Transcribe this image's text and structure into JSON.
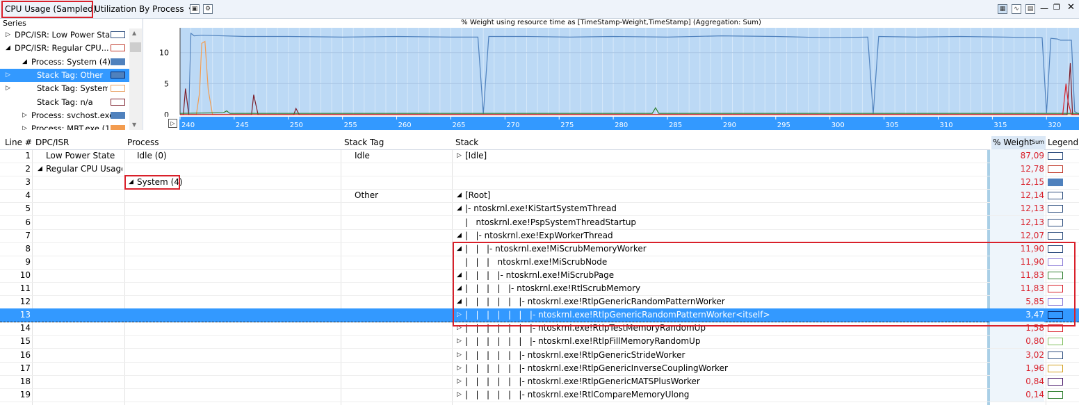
{
  "toolbar": {
    "graph_title": "CPU Usage (Sampled)",
    "view_select": "Utilization By Process",
    "dropdown_glyph": "▾"
  },
  "series_panel": {
    "header": "Series",
    "items": [
      {
        "label": "DPC/ISR: Low Power Sta...",
        "expand": "▷",
        "color": "#ffffff",
        "border": "#2f4f7f",
        "indent": 1
      },
      {
        "label": "DPC/ISR: Regular CPU...",
        "expand": "◢",
        "color": "#ffffff",
        "border": "#c0392b",
        "indent": 1
      },
      {
        "label": "Process: System (4)",
        "expand": "◢",
        "color": "#4f81bd",
        "border": "#4f81bd",
        "indent": 2
      },
      {
        "label": "Stack Tag: Other",
        "expand": "▷",
        "color": "#4f81bd",
        "border": "#0b2a6b",
        "indent": 3
      },
      {
        "label": "Stack Tag: System",
        "expand": "▷",
        "color": "#ffffff",
        "border": "#e8a060",
        "indent": 3
      },
      {
        "label": "Stack Tag: n/a",
        "expand": "",
        "color": "#ffffff",
        "border": "#7b1d2a",
        "indent": 3
      },
      {
        "label": "Process: svchost.exe...",
        "expand": "▷",
        "color": "#4f81bd",
        "border": "#4f81bd",
        "indent": 2
      },
      {
        "label": "Process: MRT.exe (1...",
        "expand": "▷",
        "color": "#f39c4f",
        "border": "#f39c4f",
        "indent": 2
      }
    ],
    "selected_index": 3
  },
  "chart_data": {
    "type": "line",
    "title": "% Weight using resource time as [TimeStamp-Weight,TimeStamp] (Aggregation: Sum)",
    "xlabel": "",
    "ylabel": "",
    "xlim": [
      240,
      323
    ],
    "ylim": [
      0,
      14
    ],
    "x_ticks": [
      240,
      245,
      250,
      255,
      260,
      265,
      270,
      275,
      280,
      285,
      290,
      295,
      300,
      305,
      310,
      315,
      320
    ],
    "y_ticks": [
      0,
      5,
      10
    ],
    "grid": true,
    "series": [
      {
        "color": "#4f81bd",
        "x": [
          240.0,
          240.8,
          241.0,
          241.3,
          242,
          246,
          250,
          255,
          260,
          265,
          267.5,
          268.0,
          268.5,
          272,
          276,
          280,
          285,
          290,
          295,
          300,
          303.5,
          304.0,
          304.5,
          308,
          312,
          316,
          319.6,
          320.0,
          320.4,
          321.0,
          321.3,
          322.3,
          322.6,
          323.0
        ],
        "y": [
          0,
          0,
          13.1,
          12.7,
          12.8,
          12.6,
          12.6,
          12.5,
          12.6,
          12.5,
          12.5,
          0.1,
          12.6,
          12.6,
          12.5,
          12.6,
          12.5,
          12.7,
          12.6,
          12.4,
          12.5,
          0.1,
          12.6,
          12.5,
          12.6,
          12.5,
          12.4,
          0.2,
          12.3,
          12.2,
          12.0,
          12.0,
          0.5,
          0.1
        ]
      },
      {
        "color": "#f39c4f",
        "x": [
          240,
          241.5,
          241.8,
          242.0,
          242.3,
          242.6,
          243,
          323
        ],
        "y": [
          0,
          0,
          3.5,
          11.5,
          11.8,
          4.0,
          0,
          0
        ]
      },
      {
        "color": "#7b1d2a",
        "x": [
          240,
          240.3,
          240.5,
          240.8,
          246.6,
          246.8,
          247.2,
          250.5,
          250.7,
          251.0,
          321.9,
          322.2,
          322.4,
          323
        ],
        "y": [
          0,
          0,
          4.2,
          0,
          0,
          3.2,
          0,
          0,
          1.0,
          0,
          0,
          8.3,
          0,
          0
        ]
      },
      {
        "color": "#2f7f2f",
        "x": [
          240,
          244,
          244.3,
          244.6,
          283.6,
          283.9,
          284.2,
          323
        ],
        "y": [
          0.2,
          0.3,
          0.6,
          0.2,
          0.2,
          1.1,
          0.2,
          0.2
        ]
      },
      {
        "color": "#d9202a",
        "x": [
          240,
          321.5,
          321.8,
          322.0,
          322.3,
          323
        ],
        "y": [
          0,
          0,
          5.0,
          2.0,
          0,
          0
        ]
      }
    ]
  },
  "table": {
    "headers": {
      "line": "Line #",
      "dpc": "DPC/ISR",
      "process": "Process",
      "stack_tag": "Stack Tag",
      "stack": "Stack",
      "weight": "% Weight",
      "weight_agg": "Sum",
      "legend": "Legend"
    },
    "rows": [
      {
        "line": "1",
        "dpc": "Low Power State",
        "dpc_expand": "",
        "process": "Idle (0)",
        "process_expand": "",
        "stack_tag": "Idle",
        "stack_expand": "▷",
        "stack": "[Idle]",
        "weight": "87,09",
        "legend_fill": "#ffffff",
        "legend_border": "#2f4f7f"
      },
      {
        "line": "2",
        "dpc": "Regular CPU Usage",
        "dpc_expand": "◢",
        "process": "",
        "process_expand": "",
        "stack_tag": "",
        "stack_expand": "",
        "stack": "",
        "weight": "12,78",
        "legend_fill": "#ffffff",
        "legend_border": "#c0392b"
      },
      {
        "line": "3",
        "dpc": "",
        "dpc_expand": "",
        "process": "System (4)",
        "process_expand": "◢",
        "stack_tag": "",
        "stack_expand": "",
        "stack": "",
        "weight": "12,15",
        "legend_fill": "#4f81bd",
        "legend_border": "#4f81bd"
      },
      {
        "line": "4",
        "dpc": "",
        "dpc_expand": "",
        "process": "",
        "process_expand": "",
        "stack_tag": "Other",
        "stack_expand": "◢",
        "stack": "[Root]",
        "weight": "12,14",
        "legend_fill": "#ffffff",
        "legend_border": "#2f4f7f"
      },
      {
        "line": "5",
        "dpc": "",
        "dpc_expand": "",
        "process": "",
        "process_expand": "",
        "stack_tag": "",
        "stack_expand": "◢",
        "stack": "|- ntoskrnl.exe!KiStartSystemThread",
        "weight": "12,13",
        "legend_fill": "#ffffff",
        "legend_border": "#2f4f7f"
      },
      {
        "line": "6",
        "dpc": "",
        "dpc_expand": "",
        "process": "",
        "process_expand": "",
        "stack_tag": "",
        "stack_expand": "",
        "stack": "|   ntoskrnl.exe!PspSystemThreadStartup",
        "weight": "12,13",
        "legend_fill": "#ffffff",
        "legend_border": "#2f4f7f"
      },
      {
        "line": "7",
        "dpc": "",
        "dpc_expand": "",
        "process": "",
        "process_expand": "",
        "stack_tag": "",
        "stack_expand": "◢",
        "stack": "|   |- ntoskrnl.exe!ExpWorkerThread",
        "weight": "12,07",
        "legend_fill": "#ffffff",
        "legend_border": "#2f4f7f"
      },
      {
        "line": "8",
        "dpc": "",
        "dpc_expand": "",
        "process": "",
        "process_expand": "",
        "stack_tag": "",
        "stack_expand": "◢",
        "stack": "|   |   |- ntoskrnl.exe!MiScrubMemoryWorker",
        "weight": "11,90",
        "legend_fill": "#ffffff",
        "legend_border": "#2f4f7f"
      },
      {
        "line": "9",
        "dpc": "",
        "dpc_expand": "",
        "process": "",
        "process_expand": "",
        "stack_tag": "",
        "stack_expand": "",
        "stack": "|   |   |   ntoskrnl.exe!MiScrubNode",
        "weight": "11,90",
        "legend_fill": "#ffffff",
        "legend_border": "#8b7bd8"
      },
      {
        "line": "10",
        "dpc": "",
        "dpc_expand": "",
        "process": "",
        "process_expand": "",
        "stack_tag": "",
        "stack_expand": "◢",
        "stack": "|   |   |   |- ntoskrnl.exe!MiScrubPage",
        "weight": "11,83",
        "legend_fill": "#ffffff",
        "legend_border": "#2f7f2f"
      },
      {
        "line": "11",
        "dpc": "",
        "dpc_expand": "",
        "process": "",
        "process_expand": "",
        "stack_tag": "",
        "stack_expand": "◢",
        "stack": "|   |   |   |   |- ntoskrnl.exe!RtlScrubMemory",
        "weight": "11,83",
        "legend_fill": "#ffffff",
        "legend_border": "#d9202a"
      },
      {
        "line": "12",
        "dpc": "",
        "dpc_expand": "",
        "process": "",
        "process_expand": "",
        "stack_tag": "",
        "stack_expand": "◢",
        "stack": "|   |   |   |   |   |- ntoskrnl.exe!RtlpGenericRandomPatternWorker",
        "weight": "5,85",
        "legend_fill": "#ffffff",
        "legend_border": "#8b7bd8"
      },
      {
        "line": "13",
        "dpc": "",
        "dpc_expand": "",
        "process": "",
        "process_expand": "",
        "stack_tag": "",
        "stack_expand": "▷",
        "stack": "|   |   |   |   |   |   |- ntoskrnl.exe!RtlpGenericRandomPatternWorker<itself>",
        "weight": "3,47",
        "legend_fill": "#3399ff",
        "legend_border": "#0b2a6b"
      },
      {
        "line": "14",
        "dpc": "",
        "dpc_expand": "",
        "process": "",
        "process_expand": "",
        "stack_tag": "",
        "stack_expand": "▷",
        "stack": "|   |   |   |   |   |   |- ntoskrnl.exe!RtlpTestMemoryRandomUp",
        "weight": "1,58",
        "legend_fill": "#ffffff",
        "legend_border": "#d9202a"
      },
      {
        "line": "15",
        "dpc": "",
        "dpc_expand": "",
        "process": "",
        "process_expand": "",
        "stack_tag": "",
        "stack_expand": "▷",
        "stack": "|   |   |   |   |   |   |- ntoskrnl.exe!RtlpFillMemoryRandomUp",
        "weight": "0,80",
        "legend_fill": "#ffffff",
        "legend_border": "#7fbf5f"
      },
      {
        "line": "16",
        "dpc": "",
        "dpc_expand": "",
        "process": "",
        "process_expand": "",
        "stack_tag": "",
        "stack_expand": "▷",
        "stack": "|   |   |   |   |   |- ntoskrnl.exe!RtlpGenericStrideWorker",
        "weight": "3,02",
        "legend_fill": "#ffffff",
        "legend_border": "#2f4f7f"
      },
      {
        "line": "17",
        "dpc": "",
        "dpc_expand": "",
        "process": "",
        "process_expand": "",
        "stack_tag": "",
        "stack_expand": "▷",
        "stack": "|   |   |   |   |   |- ntoskrnl.exe!RtlpGenericInverseCouplingWorker",
        "weight": "1,96",
        "legend_fill": "#ffffff",
        "legend_border": "#d4a020"
      },
      {
        "line": "18",
        "dpc": "",
        "dpc_expand": "",
        "process": "",
        "process_expand": "",
        "stack_tag": "",
        "stack_expand": "▷",
        "stack": "|   |   |   |   |   |- ntoskrnl.exe!RtlpGenericMATSPlusWorker",
        "weight": "0,84",
        "legend_fill": "#ffffff",
        "legend_border": "#4a1a6b"
      },
      {
        "line": "19",
        "dpc": "",
        "dpc_expand": "",
        "process": "",
        "process_expand": "",
        "stack_tag": "",
        "stack_expand": "▷",
        "stack": "|   |   |   |   |   |- ntoskrnl.exe!RtlCompareMemoryUlong",
        "weight": "0,14",
        "legend_fill": "#ffffff",
        "legend_border": "#2f7f2f"
      }
    ],
    "selected_index": 12
  }
}
